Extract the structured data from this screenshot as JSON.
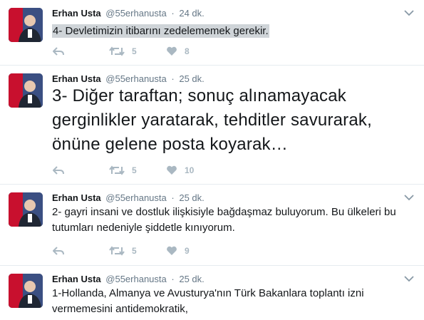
{
  "tweets": [
    {
      "name": "Erhan Usta",
      "handle": "@55erhanusta",
      "separator": "·",
      "time": "24 dk.",
      "text": "4- Devletimizin itibarını zedelememek gerekir.",
      "retweets": "5",
      "likes": "8"
    },
    {
      "name": "Erhan Usta",
      "handle": "@55erhanusta",
      "separator": "·",
      "time": "25 dk.",
      "text": "3- Diğer taraftan; sonuç alınamayacak gerginlikler yaratarak, tehditler savurarak, önüne gelene posta koyarak…",
      "retweets": "5",
      "likes": "10"
    },
    {
      "name": "Erhan Usta",
      "handle": "@55erhanusta",
      "separator": "·",
      "time": "25 dk.",
      "text": "2- gayri insani ve dostluk ilişkisiyle bağdaşmaz buluyorum. Bu ülkeleri bu tutumları nedeniyle şiddetle kınıyorum.",
      "retweets": "5",
      "likes": "9"
    },
    {
      "name": "Erhan Usta",
      "handle": "@55erhanusta",
      "separator": "·",
      "time": "25 dk.",
      "text": "1-Hollanda, Almanya ve Avusturya'nın Türk Bakanlara toplantı izni vermemesini antidemokratik,"
    }
  ],
  "icons": {
    "reply": "reply-icon",
    "retweet": "retweet-icon",
    "like": "heart-icon",
    "menu": "chevron-down-icon"
  },
  "colors": {
    "text": "#14171a",
    "muted": "#657786",
    "action": "#aab8c2",
    "divider": "#e6ecf0",
    "highlight": "#cfd4d8"
  }
}
